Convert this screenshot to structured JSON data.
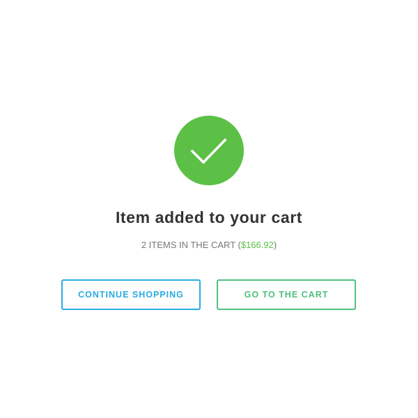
{
  "colors": {
    "success_green": "#5cc046",
    "continue_blue": "#29abe2",
    "cart_green": "#4ec07d",
    "title_text": "#333333",
    "subtitle_text": "#777777"
  },
  "confirmation": {
    "icon": "checkmark-icon",
    "title": "Item added to your cart",
    "summary_prefix": "2 ITEMS IN THE CART (",
    "summary_price": "$166.92",
    "summary_suffix": ")"
  },
  "actions": {
    "continue_label": "CONTINUE SHOPPING",
    "cart_label": "GO TO THE CART"
  }
}
